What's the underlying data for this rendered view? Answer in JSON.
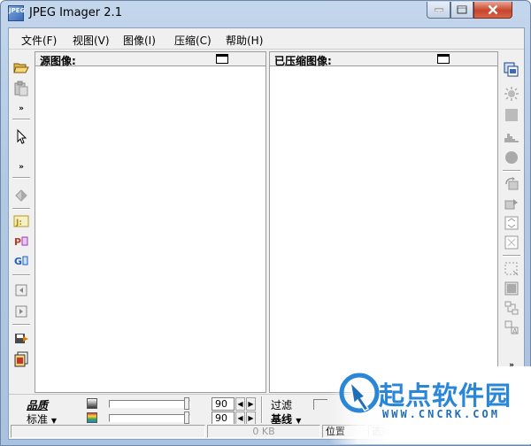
{
  "window": {
    "title": "JPEG Imager 2.1",
    "app_icon_text": "JPEG",
    "controls": [
      "minimize",
      "maximize",
      "close"
    ]
  },
  "menu": {
    "file": "文件(F)",
    "view": "视图(V)",
    "image": "图像(I)",
    "compress": "压缩(C)",
    "help": "帮助(H)"
  },
  "panes": {
    "source_label": "源图像:",
    "compressed_label": "已压缩图像:"
  },
  "left_toolbar": {
    "icons": [
      "open-folder-icon",
      "paste-icon",
      "more-chevron-icon",
      "select-arrow-icon",
      "more-chevron-icon",
      "color-picker-icon",
      "jpeg-icon",
      "png-icon",
      "gif-icon",
      "nav-back-icon",
      "nav-forward-icon",
      "save-icon",
      "batch-icon"
    ]
  },
  "right_toolbar": {
    "icons": [
      "copy-window-icon",
      "brightness-icon",
      "rect-icon",
      "histogram-icon",
      "circle-icon",
      "rotate-icon",
      "flip-icon",
      "resize-icon",
      "crop-icon",
      "select-region-icon",
      "grid-icon",
      "compare-icon",
      "text-icon",
      "more-chevron-icon"
    ]
  },
  "bottom": {
    "quality_label": "品质",
    "standard_label": "标准",
    "luma_quality": 90,
    "chroma_quality": 90,
    "filter_label": "过滤",
    "baseline_label": "基线"
  },
  "status": {
    "size_text": "0 KB",
    "position_label": "位置",
    "selection_label": "选择"
  },
  "watermark": {
    "text": "起点软件园",
    "url": "WWW.CNCRK.COM"
  },
  "colors": {
    "frame": "#b2c9e3",
    "close_button": "#c7452b",
    "watermark_blue": "#2a86d6"
  }
}
